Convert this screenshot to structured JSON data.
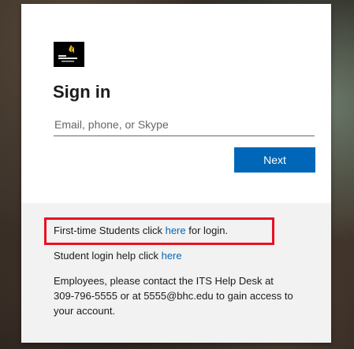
{
  "logo": {
    "name": "college-logo-icon"
  },
  "signin": {
    "title": "Sign in",
    "email_placeholder": "Email, phone, or Skype",
    "next_label": "Next"
  },
  "info": {
    "first_time_prefix": "First-time Students click ",
    "first_time_link": "here",
    "first_time_suffix": " for login.",
    "help_prefix": "Student login help click ",
    "help_link": "here",
    "employees_line1": "Employees, please contact the ITS Help Desk at",
    "employees_line2": "309-796-5555 or at 5555@bhc.edu to gain access to",
    "employees_line3": "your account."
  },
  "colors": {
    "accent": "#0067b8",
    "highlight": "#e81123",
    "panel_bg": "#f2f2f2"
  }
}
